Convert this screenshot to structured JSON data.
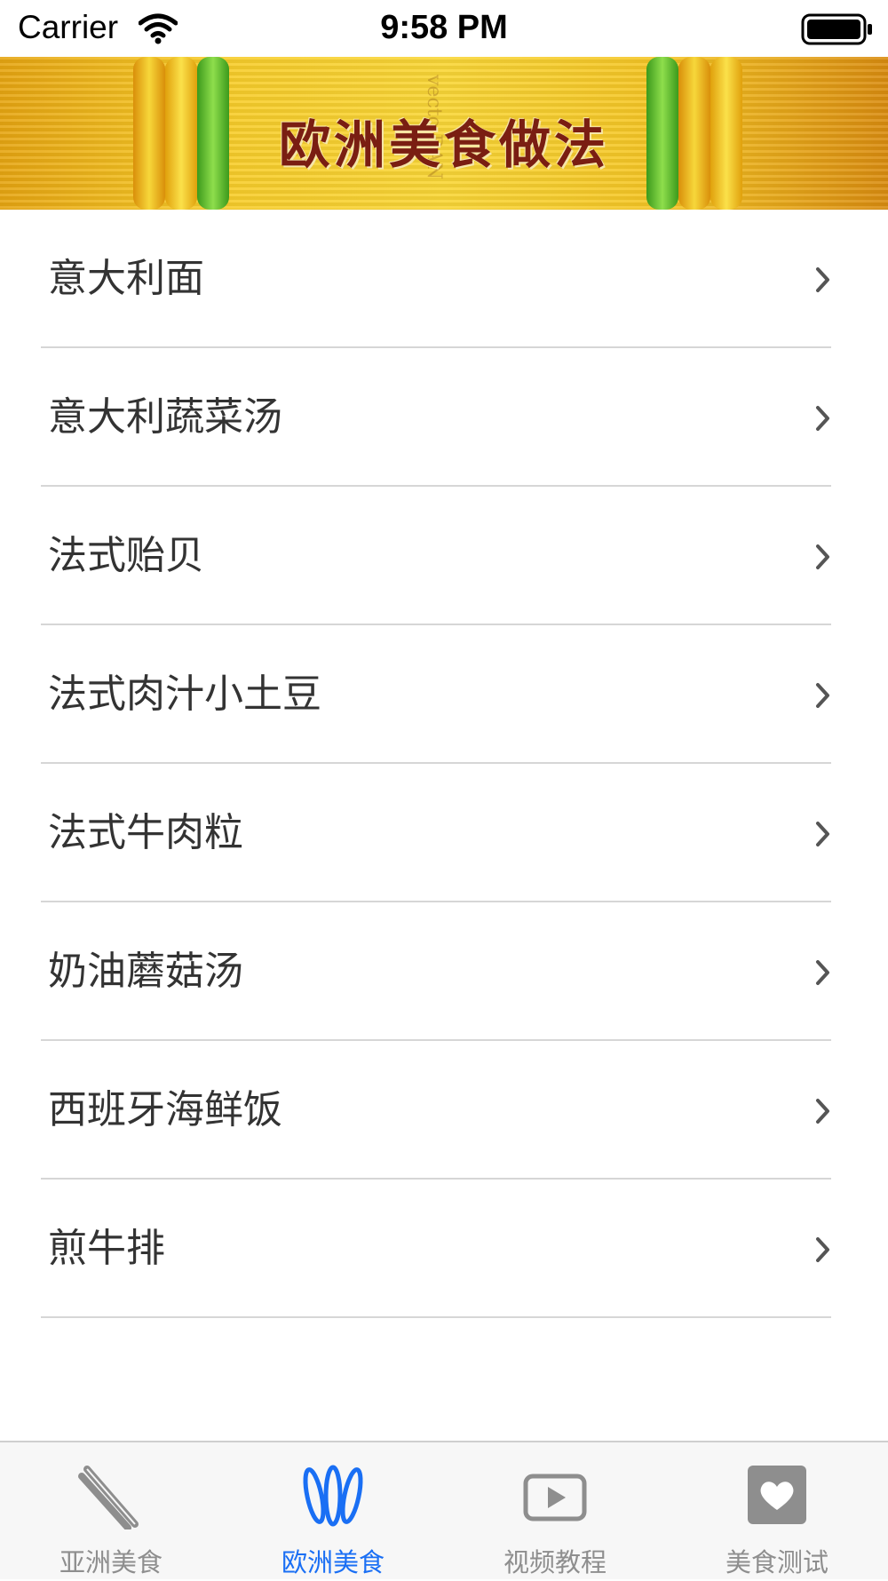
{
  "status_bar": {
    "carrier": "Carrier",
    "time": "9:58 PM",
    "icons": [
      "wifi-icon",
      "battery-icon"
    ]
  },
  "banner": {
    "title": "欧洲美食做法",
    "watermark": "vecto BAN"
  },
  "recipes": [
    {
      "label": "意大利面"
    },
    {
      "label": "意大利蔬菜汤"
    },
    {
      "label": "法式贻贝"
    },
    {
      "label": "法式肉汁小土豆"
    },
    {
      "label": "法式牛肉粒"
    },
    {
      "label": "奶油蘑菇汤"
    },
    {
      "label": "西班牙海鲜饭"
    },
    {
      "label": "煎牛排"
    }
  ],
  "tab_bar": {
    "selected_index": 1,
    "tabs": [
      {
        "label": "亚洲美食",
        "icon": "chopsticks-icon"
      },
      {
        "label": "欧洲美食",
        "icon": "fork-spoon-knife-icon"
      },
      {
        "label": "视频教程",
        "icon": "play-video-icon"
      },
      {
        "label": "美食测试",
        "icon": "heart-icon"
      }
    ]
  },
  "colors": {
    "accent": "#1a6ff4",
    "tab_inactive": "#8e8e8e",
    "text": "#333333",
    "separator": "#d6d6d6",
    "banner_title": "#7a1e12"
  }
}
